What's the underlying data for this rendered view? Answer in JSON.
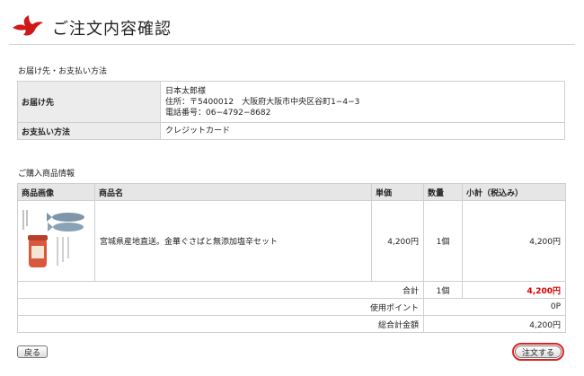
{
  "header": {
    "title": "ご注文内容確認"
  },
  "shipping_section": {
    "label": "お届け先・お支払い方法",
    "rows": [
      {
        "label": "お届け先",
        "name": "日本太郎様",
        "address": "住所：〒5400012　大阪府大阪市中央区谷町1−4−3",
        "phone": "電話番号：06−4792−8682"
      },
      {
        "label": "お支払い方法",
        "value": "クレジットカード"
      }
    ]
  },
  "items_section": {
    "label": "ご購入商品情報",
    "columns": [
      "商品画像",
      "商品名",
      "単価",
      "数量",
      "小計（税込み）"
    ],
    "item": {
      "name": "宮城県産地直送。金華ぐさばと無添加塩辛セット",
      "unit_price": "4,200円",
      "qty": "1個",
      "subtotal": "4,200円"
    },
    "summary": {
      "total_label": "合計",
      "total_qty": "1個",
      "total": "4,200円",
      "points_label": "使用ポイント",
      "points": "0P",
      "grand_label": "総合計金額",
      "grand_total": "4,200円"
    }
  },
  "buttons": {
    "back": "戻る",
    "order": "注文する"
  }
}
